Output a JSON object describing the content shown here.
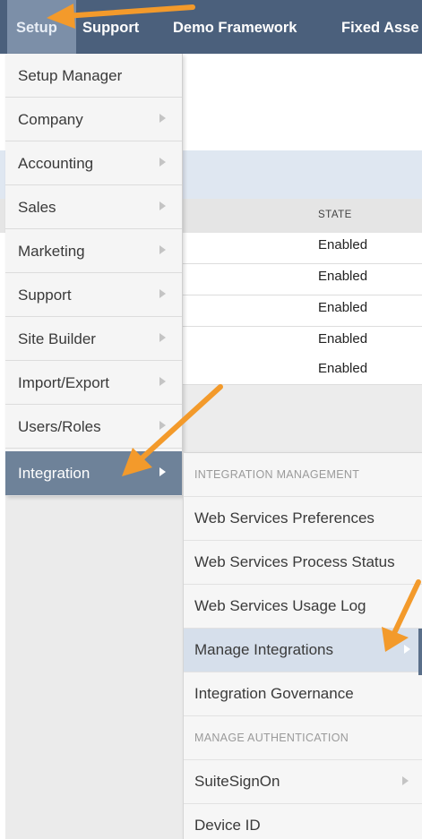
{
  "topnav": {
    "items": [
      "Setup",
      "Support",
      "Demo Framework",
      "Fixed Asse"
    ]
  },
  "table": {
    "state_header": "STATE",
    "rows": [
      "Enabled",
      "Enabled",
      "Enabled",
      "Enabled",
      "Enabled"
    ]
  },
  "menu": {
    "items": [
      {
        "label": "Setup Manager",
        "arrow": false
      },
      {
        "label": "Company",
        "arrow": true
      },
      {
        "label": "Accounting",
        "arrow": true
      },
      {
        "label": "Sales",
        "arrow": true
      },
      {
        "label": "Marketing",
        "arrow": true
      },
      {
        "label": "Support",
        "arrow": true
      },
      {
        "label": "Site Builder",
        "arrow": true
      },
      {
        "label": "Import/Export",
        "arrow": true
      },
      {
        "label": "Users/Roles",
        "arrow": true
      },
      {
        "label": "Integration",
        "arrow": true
      }
    ],
    "active": "Integration"
  },
  "submenu": {
    "section_integration": "INTEGRATION MANAGEMENT",
    "items": [
      "Web Services Preferences",
      "Web Services Process Status",
      "Web Services Usage Log",
      "Manage Integrations",
      "Integration Governance"
    ],
    "highlighted": "Manage Integrations",
    "section_auth": "MANAGE AUTHENTICATION",
    "auth_items": [
      "SuiteSignOn",
      "Device ID"
    ]
  },
  "colors": {
    "nav_bg": "#4b607c",
    "menu_active": "#6e8299",
    "submenu_highlight": "#d6dfeb",
    "annotation_arrow": "#f39a2b"
  }
}
